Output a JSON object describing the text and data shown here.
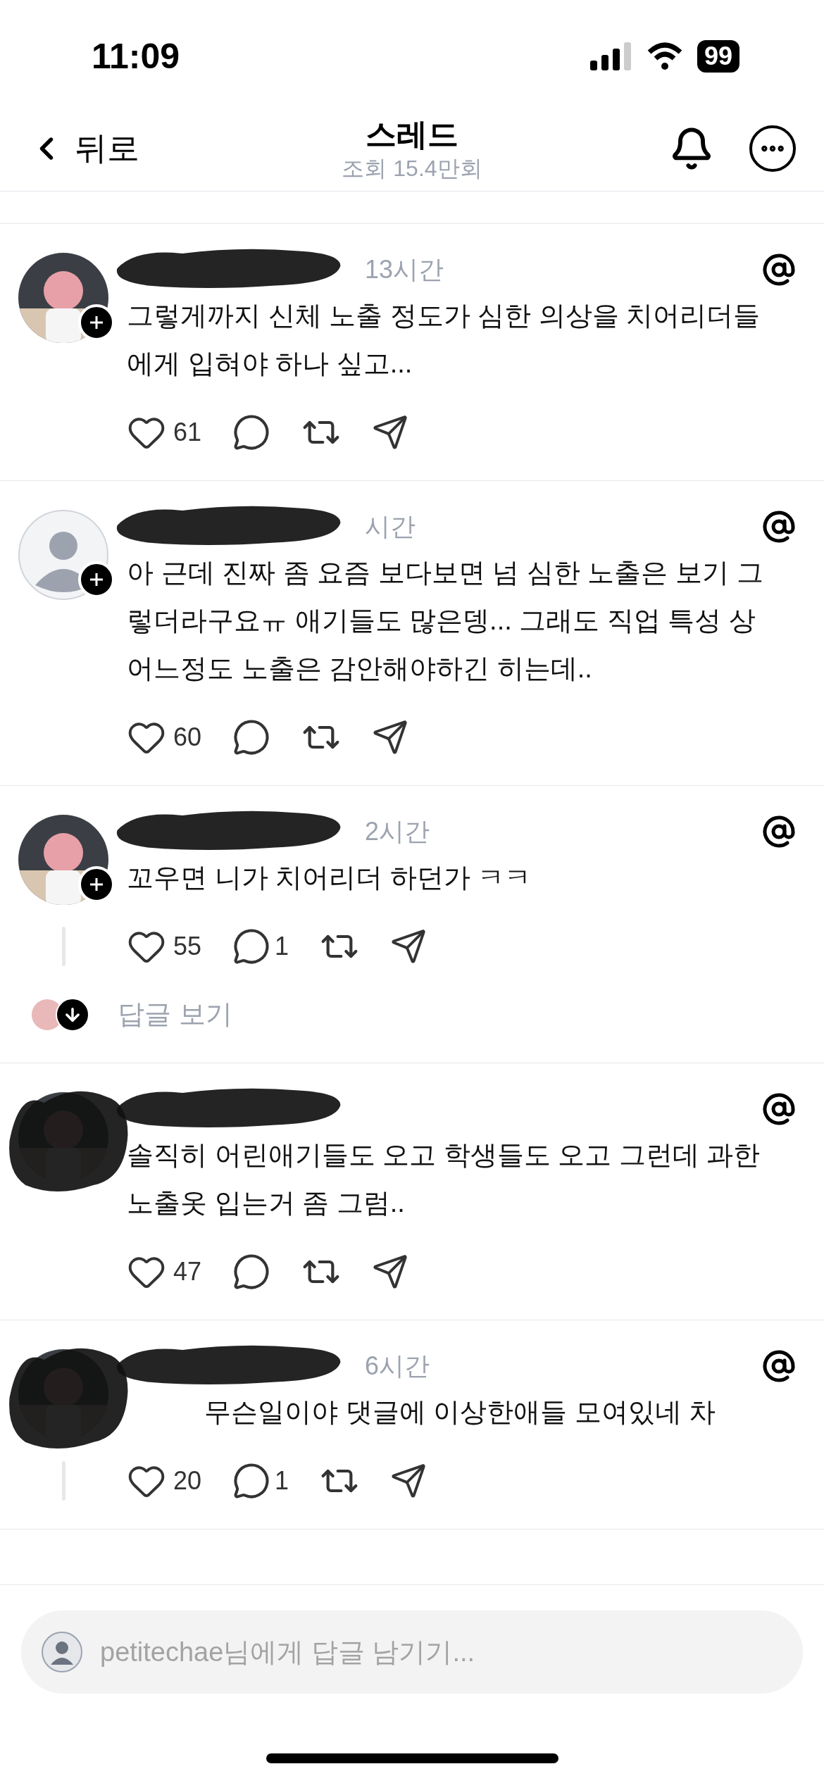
{
  "status_bar": {
    "time": "11:09",
    "battery": "99"
  },
  "header": {
    "back": "뒤로",
    "title": "스레드",
    "views": "조회 15.4만회"
  },
  "posts": [
    {
      "kind": "picture",
      "time": "13시간",
      "text": "그렇게까지 신체 노출 정도가 심한 의상을 치어리더들 에게 입혀야 하나 싶고...",
      "likes": "61",
      "thread_line": false,
      "redacted_avatar": false
    },
    {
      "kind": "default",
      "time": "시간",
      "text": "아 근데 진짜 좀 요즘 보다보면 넘 심한 노출은 보기 그 렇더라구요ㅠ 애기들도 많은뎅... 그래도 직업 특성 상 어느정도 노출은 감안해야하긴 히는데..",
      "likes": "60",
      "thread_line": false,
      "redacted_avatar": false
    },
    {
      "kind": "picture",
      "time": "2시간",
      "text": "꼬우면 니가 치어리더 하던가 ㅋㅋ",
      "likes": "55",
      "replies": "1",
      "thread_line": true,
      "show_replies": "답글 보기",
      "redacted_avatar": false
    },
    {
      "kind": "picture",
      "text": "솔직히 어린애기들도 오고 학생들도 오고 그런데 과한 노출옷 입는거 좀 그럼..",
      "likes": "47",
      "thread_line": false,
      "redacted_avatar": true
    },
    {
      "kind": "picture",
      "time": "6시간",
      "text": "무슨일이야 댓글에 이상한애들 모여있네 차",
      "likes": "20",
      "replies": "1",
      "thread_line": true,
      "redacted_avatar": true
    }
  ],
  "reply_bar": {
    "placeholder": "petitechae님에게 답글 남기기..."
  }
}
